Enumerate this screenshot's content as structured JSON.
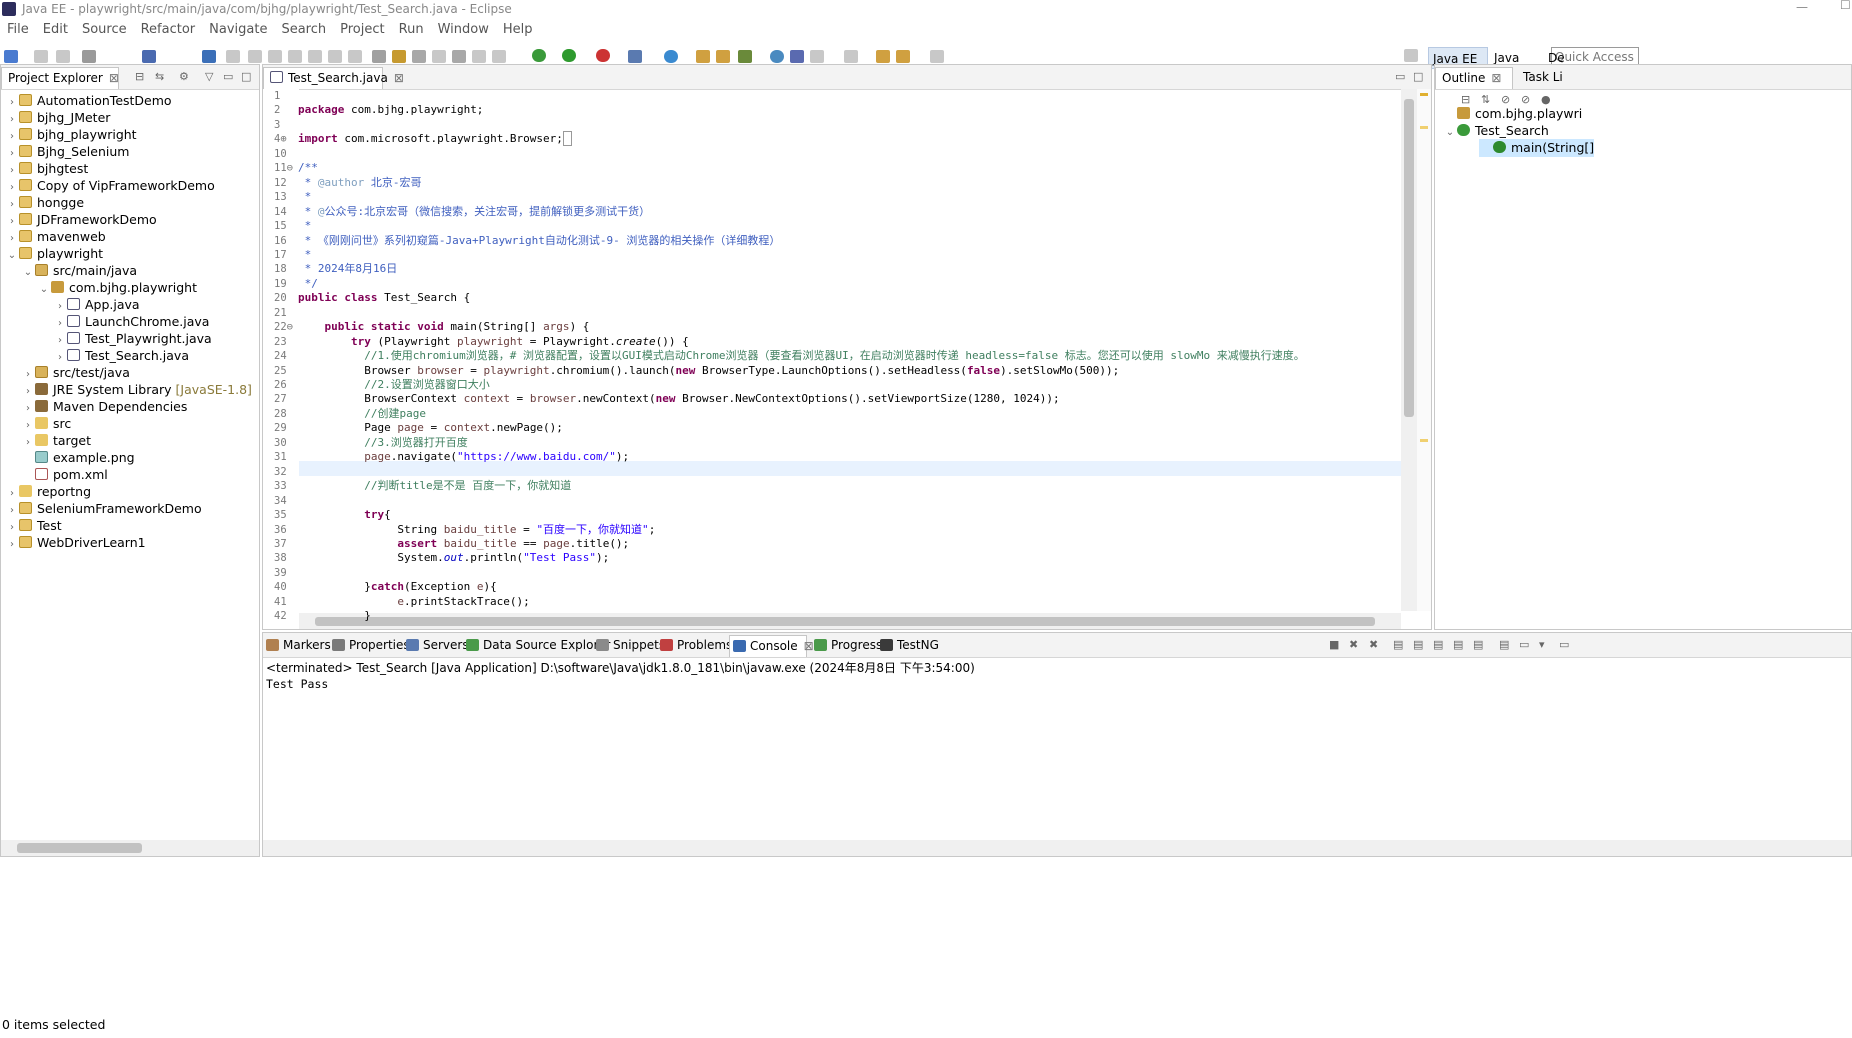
{
  "window": {
    "title": "Java EE - playwright/src/main/java/com/bjhg/playwright/Test_Search.java - Eclipse",
    "minimize_glyph": "—",
    "maximize_glyph": "☐"
  },
  "menubar": [
    "File",
    "Edit",
    "Source",
    "Refactor",
    "Navigate",
    "Search",
    "Project",
    "Run",
    "Window",
    "Help"
  ],
  "toolbar": {
    "quick_access_placeholder": "Quick Access"
  },
  "perspectives": [
    "Java EE",
    "Java",
    "De"
  ],
  "project_explorer": {
    "tab_label": "Project Explorer",
    "items": [
      {
        "label": "AutomationTestDemo",
        "level": 0,
        "expanded": false,
        "icon": "project"
      },
      {
        "label": "bjhg_JMeter",
        "level": 0,
        "expanded": false,
        "icon": "project"
      },
      {
        "label": "bjhg_playwright",
        "level": 0,
        "expanded": false,
        "icon": "project"
      },
      {
        "label": "Bjhg_Selenium",
        "level": 0,
        "expanded": false,
        "icon": "project"
      },
      {
        "label": "bjhgtest",
        "level": 0,
        "expanded": false,
        "icon": "project"
      },
      {
        "label": "Copy of VipFrameworkDemo",
        "level": 0,
        "expanded": false,
        "icon": "project"
      },
      {
        "label": "hongge",
        "level": 0,
        "expanded": false,
        "icon": "project"
      },
      {
        "label": "JDFrameworkDemo",
        "level": 0,
        "expanded": false,
        "icon": "project"
      },
      {
        "label": "mavenweb",
        "level": 0,
        "expanded": false,
        "icon": "project"
      },
      {
        "label": "playwright",
        "level": 0,
        "expanded": true,
        "icon": "project"
      },
      {
        "label": "src/main/java",
        "level": 1,
        "expanded": true,
        "icon": "pkgfolder"
      },
      {
        "label": "com.bjhg.playwright",
        "level": 2,
        "expanded": true,
        "icon": "pkg"
      },
      {
        "label": "App.java",
        "level": 3,
        "expanded": false,
        "icon": "java"
      },
      {
        "label": "LaunchChrome.java",
        "level": 3,
        "expanded": false,
        "icon": "java"
      },
      {
        "label": "Test_Playwright.java",
        "level": 3,
        "expanded": false,
        "icon": "java"
      },
      {
        "label": "Test_Search.java",
        "level": 3,
        "expanded": false,
        "icon": "java"
      },
      {
        "label": "src/test/java",
        "level": 1,
        "expanded": false,
        "icon": "pkgfolder"
      },
      {
        "label": "JRE System Library",
        "suffix": "[JavaSE-1.8]",
        "level": 1,
        "expanded": false,
        "icon": "lib"
      },
      {
        "label": "Maven Dependencies",
        "level": 1,
        "expanded": false,
        "icon": "lib"
      },
      {
        "label": "src",
        "level": 1,
        "expanded": false,
        "icon": "folder"
      },
      {
        "label": "target",
        "level": 1,
        "expanded": false,
        "icon": "folder"
      },
      {
        "label": "example.png",
        "level": 1,
        "leaf": true,
        "icon": "img"
      },
      {
        "label": "pom.xml",
        "level": 1,
        "leaf": true,
        "icon": "xml"
      },
      {
        "label": "reportng",
        "level": 0,
        "expanded": false,
        "icon": "folder"
      },
      {
        "label": "SeleniumFrameworkDemo",
        "level": 0,
        "expanded": false,
        "icon": "project"
      },
      {
        "label": "Test",
        "level": 0,
        "expanded": false,
        "icon": "project"
      },
      {
        "label": "WebDriverLearn1",
        "level": 0,
        "expanded": false,
        "icon": "project"
      }
    ]
  },
  "editor": {
    "tab_label": "Test_Search.java",
    "lines": [
      {
        "n": "1",
        "html": ""
      },
      {
        "n": "2",
        "html": "<span class='kw'>package</span> com.bjhg.playwright;"
      },
      {
        "n": "3",
        "html": ""
      },
      {
        "n": "4⊕",
        "html": "<span class='kw'>import</span> com.microsoft.playwright.Browser;<span style='border:1px solid #999'>&nbsp;</span>"
      },
      {
        "n": "10",
        "html": ""
      },
      {
        "n": "11⊖",
        "html": "<span class='jd'>/**</span>"
      },
      {
        "n": "12",
        "html": "<span class='jd'> * </span><span class='jdtag'>@author</span><span class='jd'> 北京-宏哥</span>"
      },
      {
        "n": "13",
        "html": "<span class='jd'> *</span>"
      },
      {
        "n": "14",
        "html": "<span class='jd'> * </span><span class='jdtag'>@</span><span class='jd'>公众号:北京宏哥（微信搜索，关注宏哥，提前解锁更多测试干货）</span>"
      },
      {
        "n": "15",
        "html": "<span class='jd'> *</span>"
      },
      {
        "n": "16",
        "html": "<span class='jd'> * 《刚刚问世》系列初窥篇-Java+Playwright自动化测试-9- 浏览器的相关操作（详细教程）</span>"
      },
      {
        "n": "17",
        "html": "<span class='jd'> *</span>"
      },
      {
        "n": "18",
        "html": "<span class='jd'> * 2024年8月16日</span>"
      },
      {
        "n": "19",
        "html": "<span class='jd'> */</span>"
      },
      {
        "n": "20",
        "html": "<span class='kw'>public class</span> Test_Search {"
      },
      {
        "n": "21",
        "html": ""
      },
      {
        "n": "22⊖",
        "html": "    <span class='kw'>public static void</span> main(String[] <span class='var'>args</span>) {"
      },
      {
        "n": "23",
        "html": "        <span class='kw'>try</span> (Playwright <span class='var'>playwright</span> = Playwright.<i>create</i>()) {"
      },
      {
        "n": "24",
        "html": "          <span class='cm'>//1.使用chromium浏览器，# 浏览器配置，设置以GUI模式启动Chrome浏览器（要查看浏览器UI，在启动浏览器时传递 headless=false 标志。您还可以使用 slowMo 来减慢执行速度。</span>"
      },
      {
        "n": "25",
        "html": "          Browser <span class='var'>browser</span> = <span class='var'>playwright</span>.chromium().launch(<span class='kw'>new</span> BrowserType.LaunchOptions().setHeadless(<span class='kw'>false</span>).setSlowMo(500));"
      },
      {
        "n": "26",
        "html": "          <span class='cm'>//2.设置浏览器窗口大小</span>"
      },
      {
        "n": "27",
        "html": "          BrowserContext <span class='var'>context</span> = <span class='var'>browser</span>.newContext(<span class='kw'>new</span> Browser.NewContextOptions().setViewportSize(1280, 1024));"
      },
      {
        "n": "28",
        "html": "          <span class='cm'>//创建page</span>"
      },
      {
        "n": "29",
        "html": "          Page <span class='var'>page</span> = <span class='var'>context</span>.newPage();"
      },
      {
        "n": "30",
        "html": "          <span class='cm'>//3.浏览器打开百度</span>"
      },
      {
        "n": "31",
        "html": "          <span class='var'>page</span>.navigate(<span class='str'>\"https://www.baidu.com/\"</span>);"
      },
      {
        "n": "32",
        "html": ""
      },
      {
        "n": "33",
        "html": "          <span class='cm'>//判断title是不是 百度一下，你就知道</span>"
      },
      {
        "n": "34",
        "html": ""
      },
      {
        "n": "35",
        "html": "          <span class='kw'>try</span>{"
      },
      {
        "n": "36",
        "html": "               String <span class='var'>baidu_title</span> = <span class='str'>\"百度一下，你就知道\"</span>;"
      },
      {
        "n": "37",
        "html": "               <span class='kw'>assert</span> <span class='var'>baidu_title</span> == <span class='var'>page</span>.title();"
      },
      {
        "n": "38",
        "html": "               System.<span class='fldi'>out</span>.println(<span class='str'>\"Test Pass\"</span>);"
      },
      {
        "n": "39",
        "html": ""
      },
      {
        "n": "40",
        "html": "          }<span class='kw'>catch</span>(Exception <span class='var'>e</span>){"
      },
      {
        "n": "41",
        "html": "               <span class='var'>e</span>.printStackTrace();"
      },
      {
        "n": "42",
        "html": "          }"
      }
    ]
  },
  "bottom_panel": {
    "tabs": [
      "Markers",
      "Properties",
      "Servers",
      "Data Source Explorer",
      "Snippets",
      "Problems",
      "Console",
      "Progress",
      "TestNG"
    ],
    "active_tab": "Console",
    "terminated_line": "<terminated> Test_Search [Java Application] D:\\software\\Java\\jdk1.8.0_181\\bin\\javaw.exe (2024年8月8日 下午3:54:00)",
    "output": "Test Pass"
  },
  "outline": {
    "tabs": [
      "Outline",
      "Task Li"
    ],
    "items": [
      {
        "label": "com.bjhg.playwri",
        "level": 0
      },
      {
        "label": "Test_Search",
        "level": 0,
        "expanded": true
      },
      {
        "label": "main(String[]",
        "level": 1,
        "selected": true
      }
    ]
  },
  "status_bar": {
    "text": "0 items selected"
  },
  "colors": {
    "selection": "#cce8ff",
    "current_line": "#e8f2fe",
    "keyword": "#7f0055",
    "comment": "#3f7f5f",
    "javadoc": "#3f5fbf",
    "string": "#2a00ff"
  }
}
